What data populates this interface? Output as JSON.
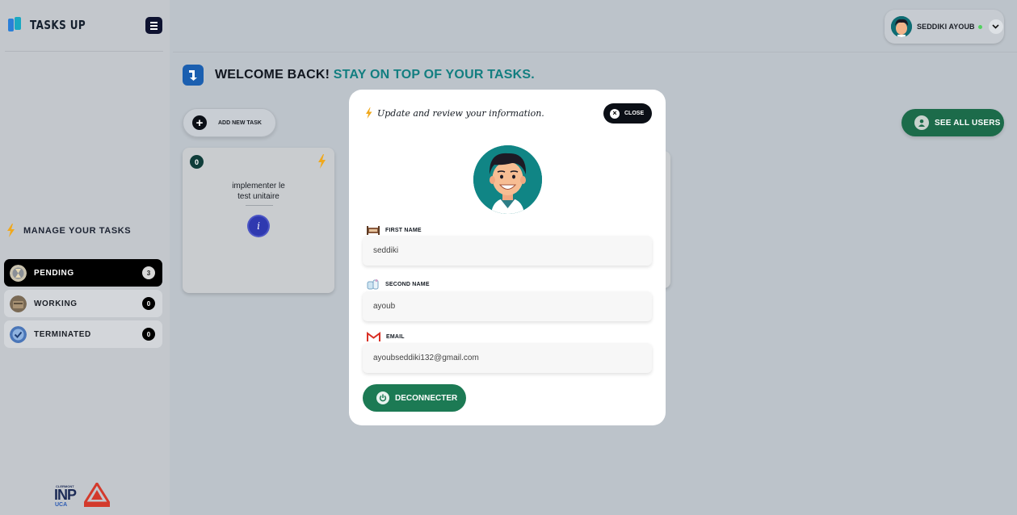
{
  "brand": {
    "name": "TASKS UP"
  },
  "sidebar": {
    "section_title": "MANAGE YOUR TASKS",
    "items": [
      {
        "label": "PENDING",
        "count": "3",
        "active": true
      },
      {
        "label": "WORKING",
        "count": "0",
        "active": false
      },
      {
        "label": "TERMINATED",
        "count": "0",
        "active": false
      }
    ]
  },
  "header": {
    "user_name": "SEDDIKI AYOUB",
    "online_color": "#52d15f"
  },
  "main": {
    "welcome_primary": "WELCOME BACK!",
    "welcome_accent": "STAY ON TOP OF YOUR TASKS.",
    "accent_color": "#127e80",
    "add_task_label": "ADD NEW TASK",
    "see_users_label": "SEE ALL USERS",
    "task_card": {
      "index": "0",
      "title": "implementer le test unitaire"
    }
  },
  "modal": {
    "title": "Update and review your information.",
    "close_label": "CLOSE",
    "first_name_label": "FIRST NAME",
    "first_name_value": "seddiki",
    "second_name_label": "SECOND NAME",
    "second_name_value": "ayoub",
    "email_label": "EMAIL",
    "email_value": "ayoubseddiki132@gmail.com",
    "deconnect_label": "DECONNECTER",
    "button_color": "#1c7a54"
  }
}
